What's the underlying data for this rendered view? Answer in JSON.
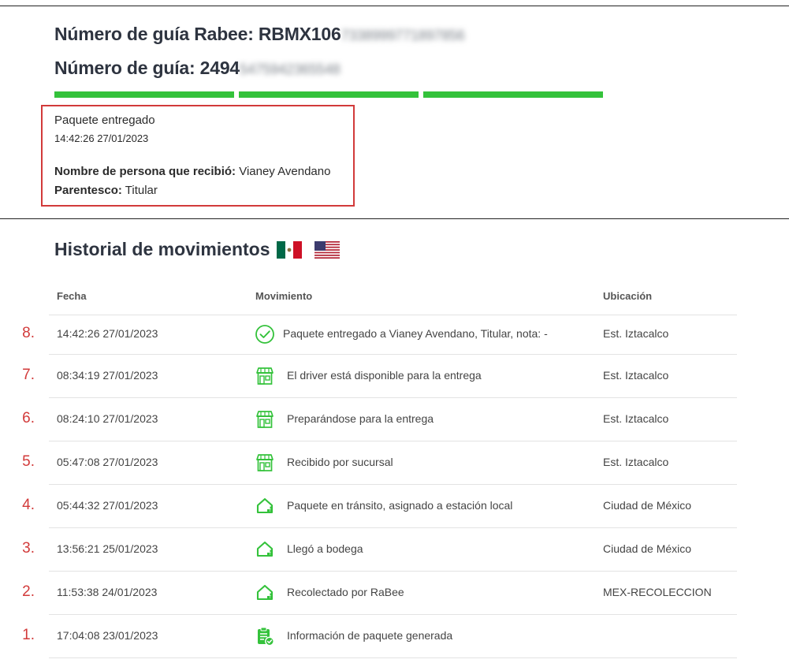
{
  "header": {
    "rabee_label": "Número de guía Rabee: RBMX106",
    "rabee_suffix": "7338999771897856",
    "guide_label": "Número de guía: 2494",
    "guide_suffix": "5475942365548"
  },
  "status": {
    "title": "Paquete entregado",
    "timestamp": "14:42:26 27/01/2023",
    "receiver_label": "Nombre de persona que recibió:",
    "receiver_value": "Vianey Avendano",
    "relation_label": "Parentesco:",
    "relation_value": "Titular",
    "progress_steps_complete": 3,
    "progress_steps_total": 3,
    "progress_color": "#34c23b"
  },
  "history": {
    "title": "Historial de movimientos",
    "columns": {
      "date": "Fecha",
      "movement": "Movimiento",
      "location": "Ubicación"
    },
    "rows": [
      {
        "num": "8.",
        "date": "14:42:26 27/01/2023",
        "icon": "check-circle-icon",
        "movement": "Paquete entregado a Vianey Avendano, Titular, nota: -",
        "location": "Est. Iztacalco"
      },
      {
        "num": "7.",
        "date": "08:34:19 27/01/2023",
        "icon": "store-icon",
        "movement": "El driver está disponible para la entrega",
        "location": "Est. Iztacalco"
      },
      {
        "num": "6.",
        "date": "08:24:10 27/01/2023",
        "icon": "store-icon",
        "movement": "Preparándose para la entrega",
        "location": "Est. Iztacalco"
      },
      {
        "num": "5.",
        "date": "05:47:08 27/01/2023",
        "icon": "store-icon",
        "movement": "Recibido por sucursal",
        "location": "Est. Iztacalco"
      },
      {
        "num": "4.",
        "date": "05:44:32 27/01/2023",
        "icon": "warehouse-icon",
        "movement": "Paquete en tránsito, asignado a estación local",
        "location": "Ciudad de México"
      },
      {
        "num": "3.",
        "date": "13:56:21 25/01/2023",
        "icon": "warehouse-icon",
        "movement": "Llegó a bodega",
        "location": "Ciudad de México"
      },
      {
        "num": "2.",
        "date": "11:53:38 24/01/2023",
        "icon": "warehouse-icon",
        "movement": "Recolectado por RaBee",
        "location": "MEX-RECOLECCION"
      },
      {
        "num": "1.",
        "date": "17:04:08 23/01/2023",
        "icon": "clipboard-check-icon",
        "movement": "Información de paquete generada",
        "location": ""
      }
    ]
  },
  "colors": {
    "accent_green": "#34c23b",
    "annotation_red": "#d23a3a"
  }
}
